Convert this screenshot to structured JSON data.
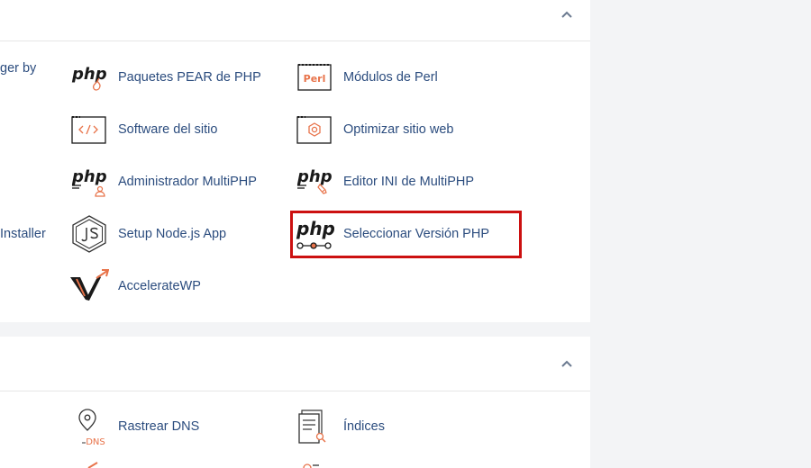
{
  "colors": {
    "link": "#2b4c7e",
    "accent": "#e8734a",
    "highlight": "#cc1010"
  },
  "panel1": {
    "collapse_icon": "chevron-up-icon",
    "cut_labels": [
      "ger by",
      "Installer"
    ],
    "items": [
      {
        "label": "Paquetes PEAR de PHP",
        "icon": "php-pear-icon"
      },
      {
        "label": "Módulos de Perl",
        "icon": "perl-icon"
      },
      {
        "label": "Software del sitio",
        "icon": "code-window-icon"
      },
      {
        "label": "Optimizar sitio web",
        "icon": "optimize-window-icon"
      },
      {
        "label": "Administrador MultiPHP",
        "icon": "php-user-icon"
      },
      {
        "label": "Editor INI de MultiPHP",
        "icon": "php-edit-icon"
      },
      {
        "label": "Setup Node.js App",
        "icon": "nodejs-icon"
      },
      {
        "label": "Seleccionar Versión PHP",
        "icon": "php-selector-icon"
      },
      {
        "label": "AccelerateWP",
        "icon": "acceleratewp-icon"
      }
    ]
  },
  "panel2": {
    "collapse_icon": "chevron-up-icon",
    "items": [
      {
        "label": "Rastrear DNS",
        "icon": "dns-pin-icon",
        "icon_text": "DNS"
      },
      {
        "label": "Índices",
        "icon": "index-document-icon"
      }
    ]
  },
  "perl_icon_text": "Perl",
  "php_icon_text": "php"
}
